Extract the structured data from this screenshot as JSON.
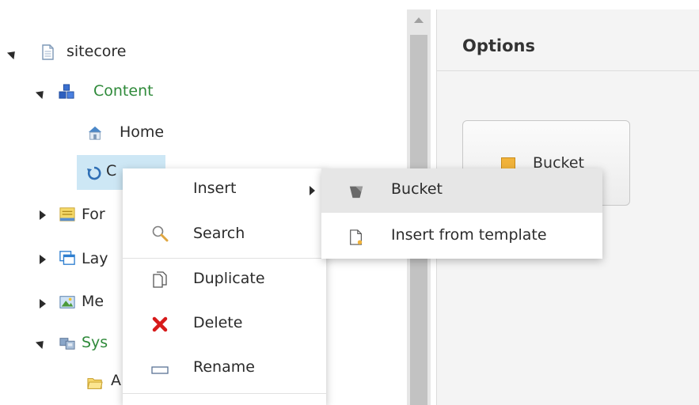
{
  "tree": {
    "root": {
      "label": "sitecore",
      "state": "expanded"
    },
    "content": {
      "label": "Content",
      "state": "expanded"
    },
    "home": {
      "label": "Home"
    },
    "cms": {
      "label": "CMS",
      "visible": "C"
    },
    "forms": {
      "label": "For",
      "state": "collapsed"
    },
    "layout": {
      "label": "Lay",
      "state": "collapsed"
    },
    "media": {
      "label": "Me",
      "state": "collapsed"
    },
    "system": {
      "label": "Sys",
      "state": "expanded"
    },
    "system_child": {
      "label": "A"
    }
  },
  "options": {
    "title": "Options",
    "bucket_button": {
      "label": "Bucket"
    }
  },
  "context_menu": {
    "items": [
      {
        "label": "Insert",
        "icon": "none",
        "has_submenu": true
      },
      {
        "label": "Search",
        "icon": "magnifier-icon"
      },
      {
        "label": "Duplicate",
        "icon": "duplicate-icon"
      },
      {
        "label": "Delete",
        "icon": "delete-x-icon"
      },
      {
        "label": "Rename",
        "icon": "rename-icon"
      }
    ]
  },
  "submenu": {
    "items": [
      {
        "label": "Bucket",
        "icon": "bucket-icon",
        "highlighted": true
      },
      {
        "label": "Insert from template",
        "icon": "template-icon"
      }
    ]
  },
  "colors": {
    "selection": "#cde7f5",
    "content_text": "#2f8a3a",
    "highlight": "#e6e6e6",
    "delete_red": "#d71a1a"
  }
}
